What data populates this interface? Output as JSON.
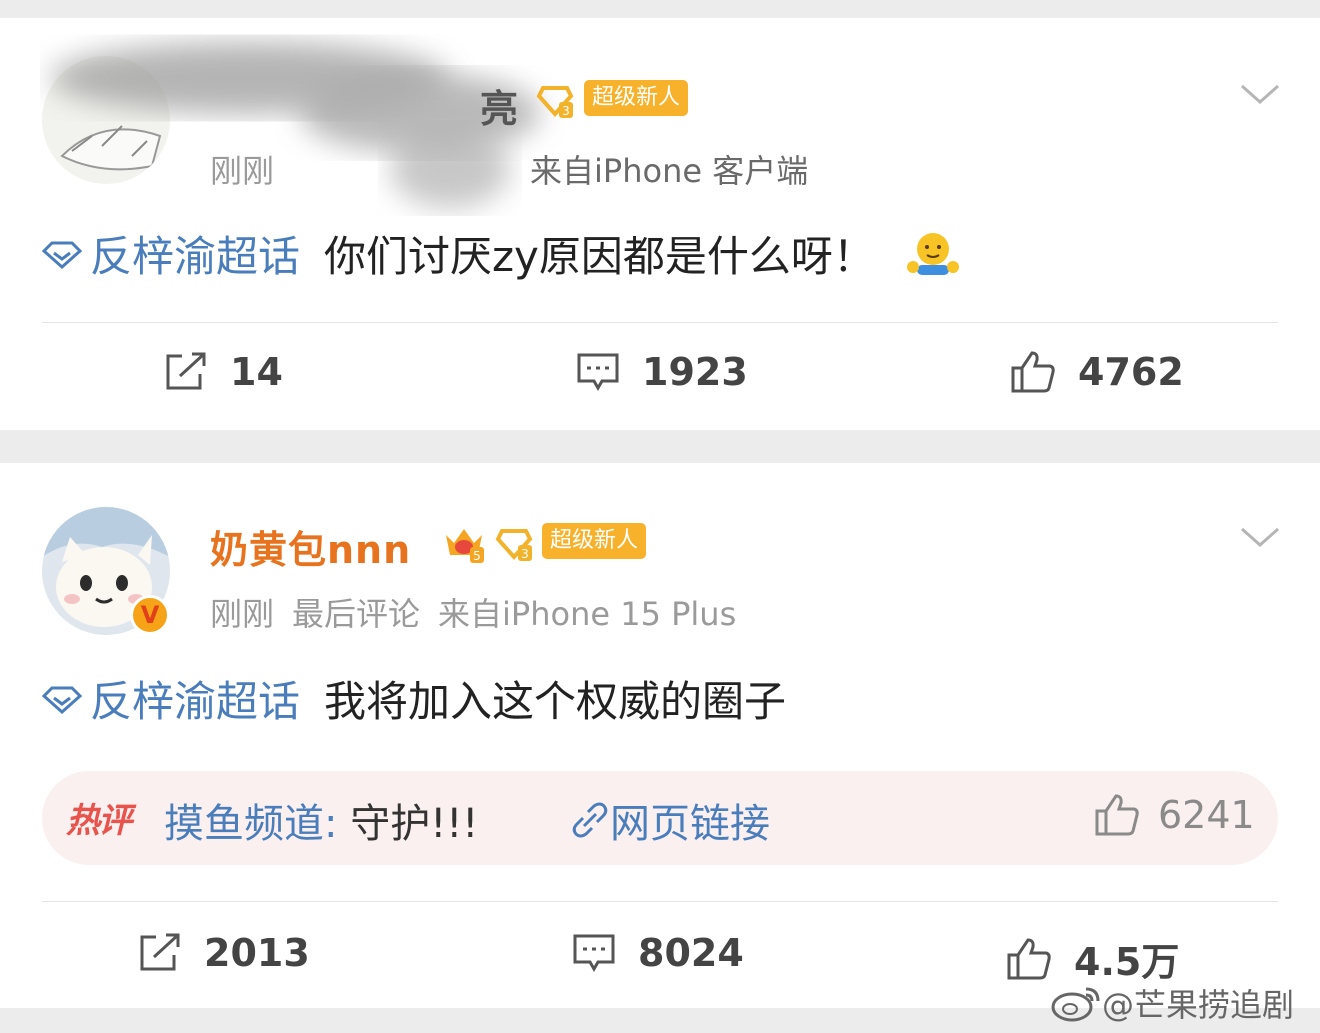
{
  "posts": [
    {
      "username": "亮",
      "tag": "超级新人",
      "meta": {
        "time": "刚刚",
        "source": "来自iPhone 客户端"
      },
      "topic": "反梓渝超话",
      "text": "你们讨厌zy原因都是什么呀！",
      "actions": {
        "repost": "14",
        "comment": "1923",
        "like": "4762"
      }
    },
    {
      "username": "奶黄包nnn",
      "tag": "超级新人",
      "meta": {
        "time": "刚刚",
        "activity": "最后评论",
        "source": "来自iPhone 15 Plus"
      },
      "topic": "反梓渝超话",
      "text": "我将加入这个权威的圈子",
      "hot_comment": {
        "label": "热评",
        "user": "摸鱼频道:",
        "content": "守护!!!",
        "link": "网页链接",
        "likes": "6241"
      },
      "actions": {
        "repost": "2013",
        "comment": "8024",
        "like": "4.5万"
      }
    }
  ],
  "watermark": "@芒果捞追剧",
  "colors": {
    "link_blue": "#4a7dbb",
    "username_orange": "#e8731e",
    "tag_yellow": "#f7b12a",
    "hot_red": "#e8534c"
  },
  "icons": [
    "repost-icon",
    "comment-icon",
    "like-icon",
    "chevron-down-icon",
    "diamond-icon",
    "link-icon",
    "verified-icon",
    "weibo-logo-icon"
  ]
}
